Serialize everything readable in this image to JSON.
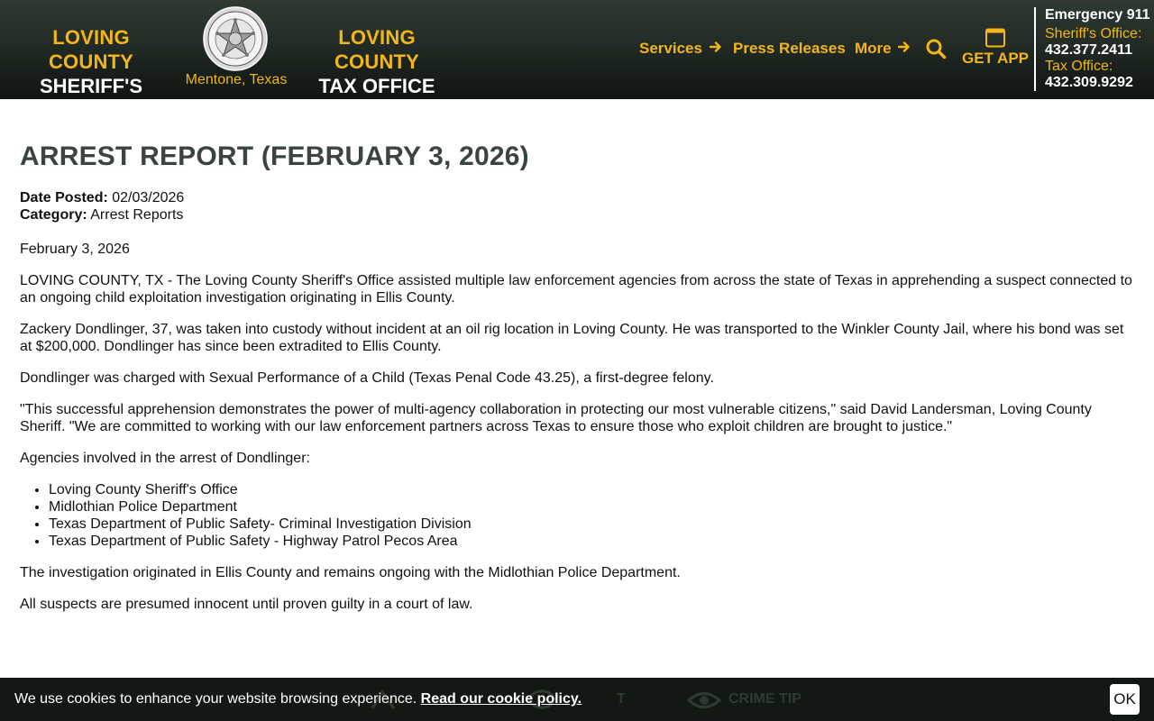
{
  "header": {
    "brand_left": {
      "line1": "LOVING COUNTY",
      "line2": "SHERIFF'S OFFICE"
    },
    "brand_right": {
      "line1": "LOVING COUNTY",
      "line2": "TAX OFFICE"
    },
    "seal_caption": "Mentone, Texas",
    "seal_logo_text": "LOVING COUNTY SHERIFF'S OFFICE",
    "nav": {
      "services": "Services",
      "press": "Press Releases",
      "more": "More"
    },
    "app_label": "GET APP",
    "contact": {
      "emergency": "Emergency 911",
      "sheriff_label": "Sheriff's Office:",
      "sheriff_phone": "432.377.2411",
      "tax_label": "Tax Office:",
      "tax_phone": "432.309.9292"
    }
  },
  "article": {
    "title": "ARREST REPORT (FEBRUARY 3, 2026)",
    "date_posted_label": "Date Posted:",
    "date_posted": "02/03/2026",
    "category_label": "Category:",
    "category": "Arrest Reports",
    "paragraphs_before_list": [
      "February 3, 2026",
      "LOVING COUNTY, TX - The Loving County Sheriff's Office assisted multiple law enforcement agencies from across the state of Texas in apprehending a suspect connected to an ongoing child exploitation investigation originating in Ellis County.",
      "Zackery Dondlinger, 37, was taken into custody without incident at an oil rig location in Loving County. He was transported to the Winkler County Jail, where his bond was set at $200,000. Dondlinger has since been extradited to Ellis County.",
      "Dondlinger was charged with Sexual Performance of a Child (Texas Penal Code 43.25), a first-degree felony.",
      "\"This successful apprehension demonstrates the power of multi-agency collaboration in protecting our most vulnerable citizens,\" said David Landersman, Loving County Sheriff. \"We are committed to working with our law enforcement partners across Texas to ensure those who exploit children are brought to justice.\"",
      "Agencies involved in the arrest of Dondlinger:"
    ],
    "agencies": [
      "Loving County Sheriff's Office",
      "Midlothian Police Department",
      "Texas Department of Public Safety- Criminal Investigation Division",
      "Texas Department of Public Safety - Highway Patrol Pecos Area"
    ],
    "paragraphs_after_list": [
      "The investigation originated in Ellis County and remains ongoing with the Midlothian Police Department.",
      "All suspects are presumed innocent until proven guilty in a court of law."
    ]
  },
  "cookie": {
    "text": "We use cookies to enhance your website browsing experience.",
    "link": "Read our cookie policy.",
    "ok": "OK",
    "bg_partial_1": "T",
    "bg_partial_2": "CRIME TIP"
  },
  "colors": {
    "accent": "#f2b619",
    "header_dark": "#1b231e",
    "title": "#3a4541"
  },
  "icons": [
    "sheriff-seal-logo",
    "arrow-right-icon",
    "search-icon",
    "phone-icon",
    "eye-icon"
  ]
}
